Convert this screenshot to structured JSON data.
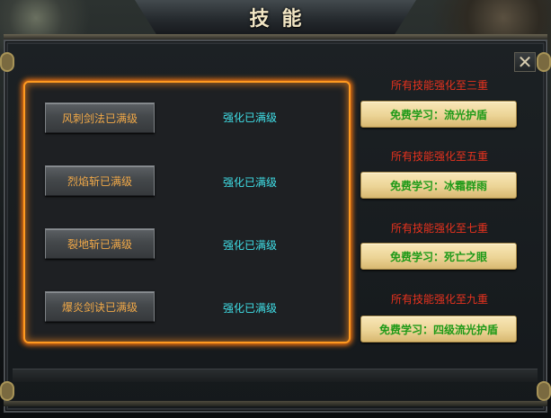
{
  "window": {
    "title": "技能",
    "close_label": "✕"
  },
  "skills": [
    {
      "name": "风刺剑法已满级",
      "status": "强化已满级"
    },
    {
      "name": "烈焰斩已满级",
      "status": "强化已满级"
    },
    {
      "name": "裂地斩已满级",
      "status": "强化已满级"
    },
    {
      "name": "爆炎剑诀已满级",
      "status": "强化已满级"
    }
  ],
  "rewards": [
    {
      "condition": "所有技能强化至三重",
      "button": "免费学习：流光护盾"
    },
    {
      "condition": "所有技能强化至五重",
      "button": "免费学习：冰霜群雨"
    },
    {
      "condition": "所有技能强化至七重",
      "button": "免费学习：死亡之眼"
    },
    {
      "condition": "所有技能强化至九重",
      "button": "免费学习：四级流光护盾"
    }
  ],
  "colors": {
    "panel_glow": "#ff9a20",
    "skill_text": "#f0a848",
    "status_text": "#40e0e8",
    "reward_condition": "#e8321e",
    "reward_button_text": "#1f9a18"
  }
}
